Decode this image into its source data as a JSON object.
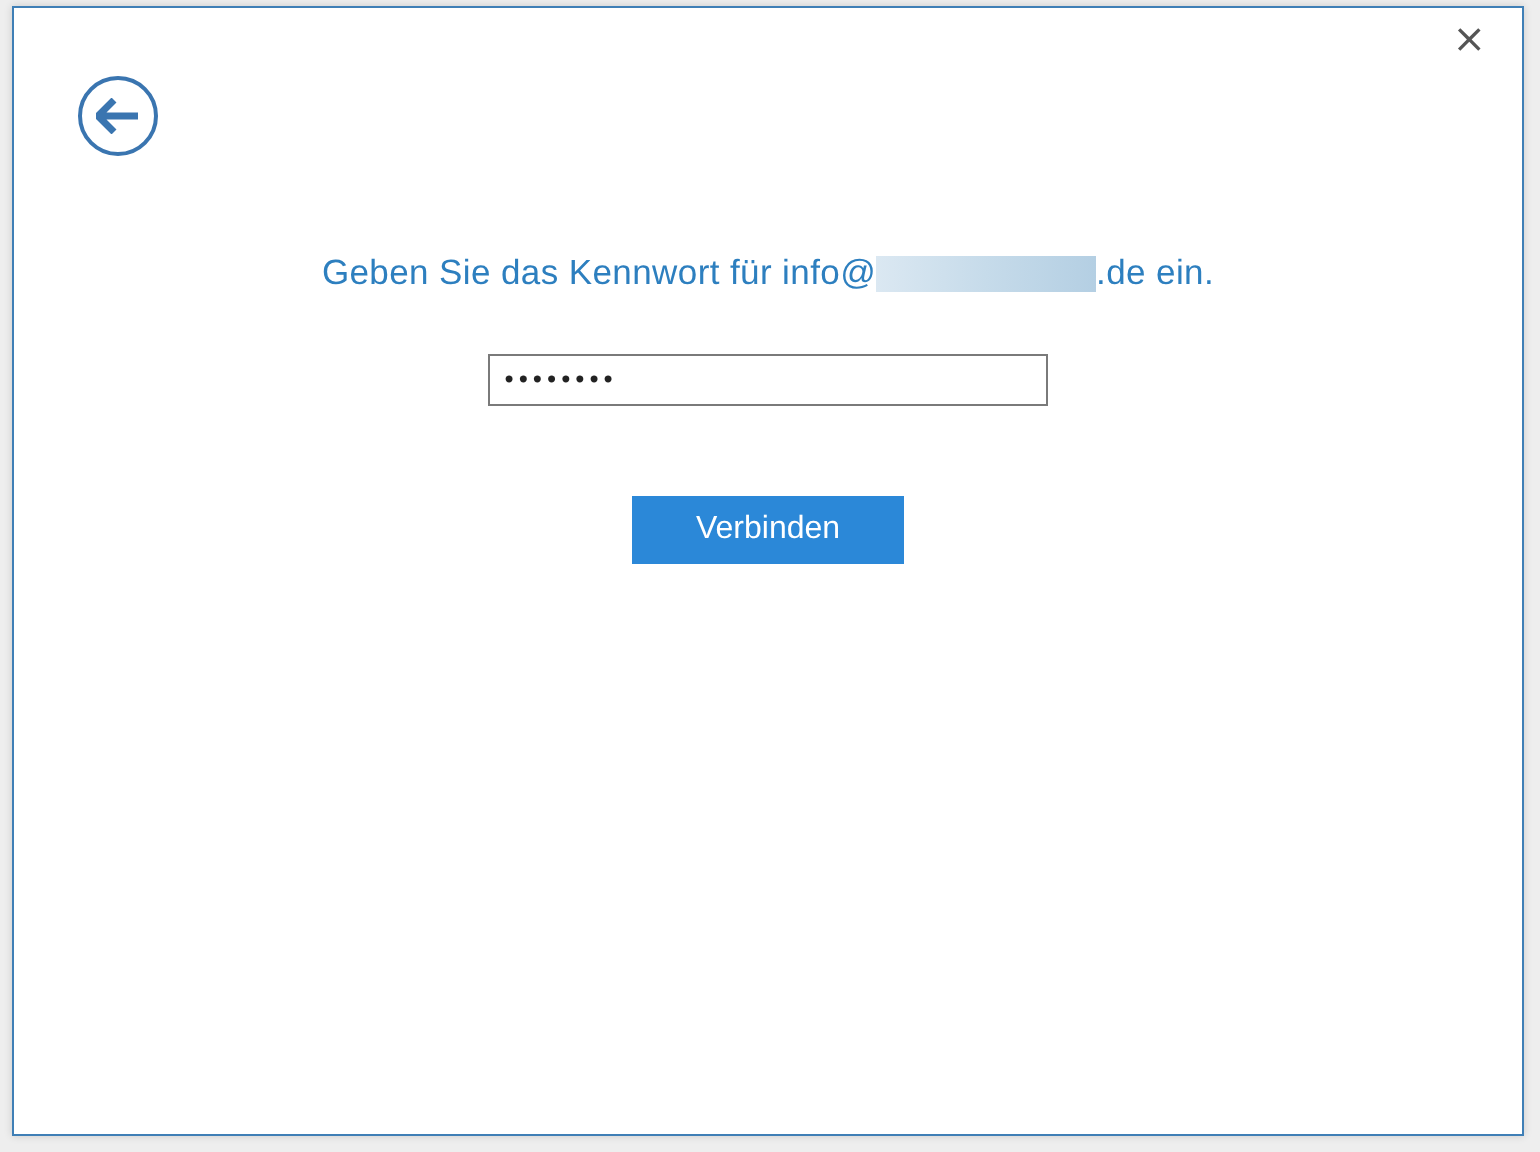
{
  "dialog": {
    "close_label": "×"
  },
  "prompt": {
    "before_redaction": "Geben Sie das Kennwort für info@",
    "after_redaction": ".de ein."
  },
  "password_field": {
    "value": "••••••••"
  },
  "buttons": [
    {
      "label": "Verbinden",
      "kind": "primary"
    }
  ]
}
